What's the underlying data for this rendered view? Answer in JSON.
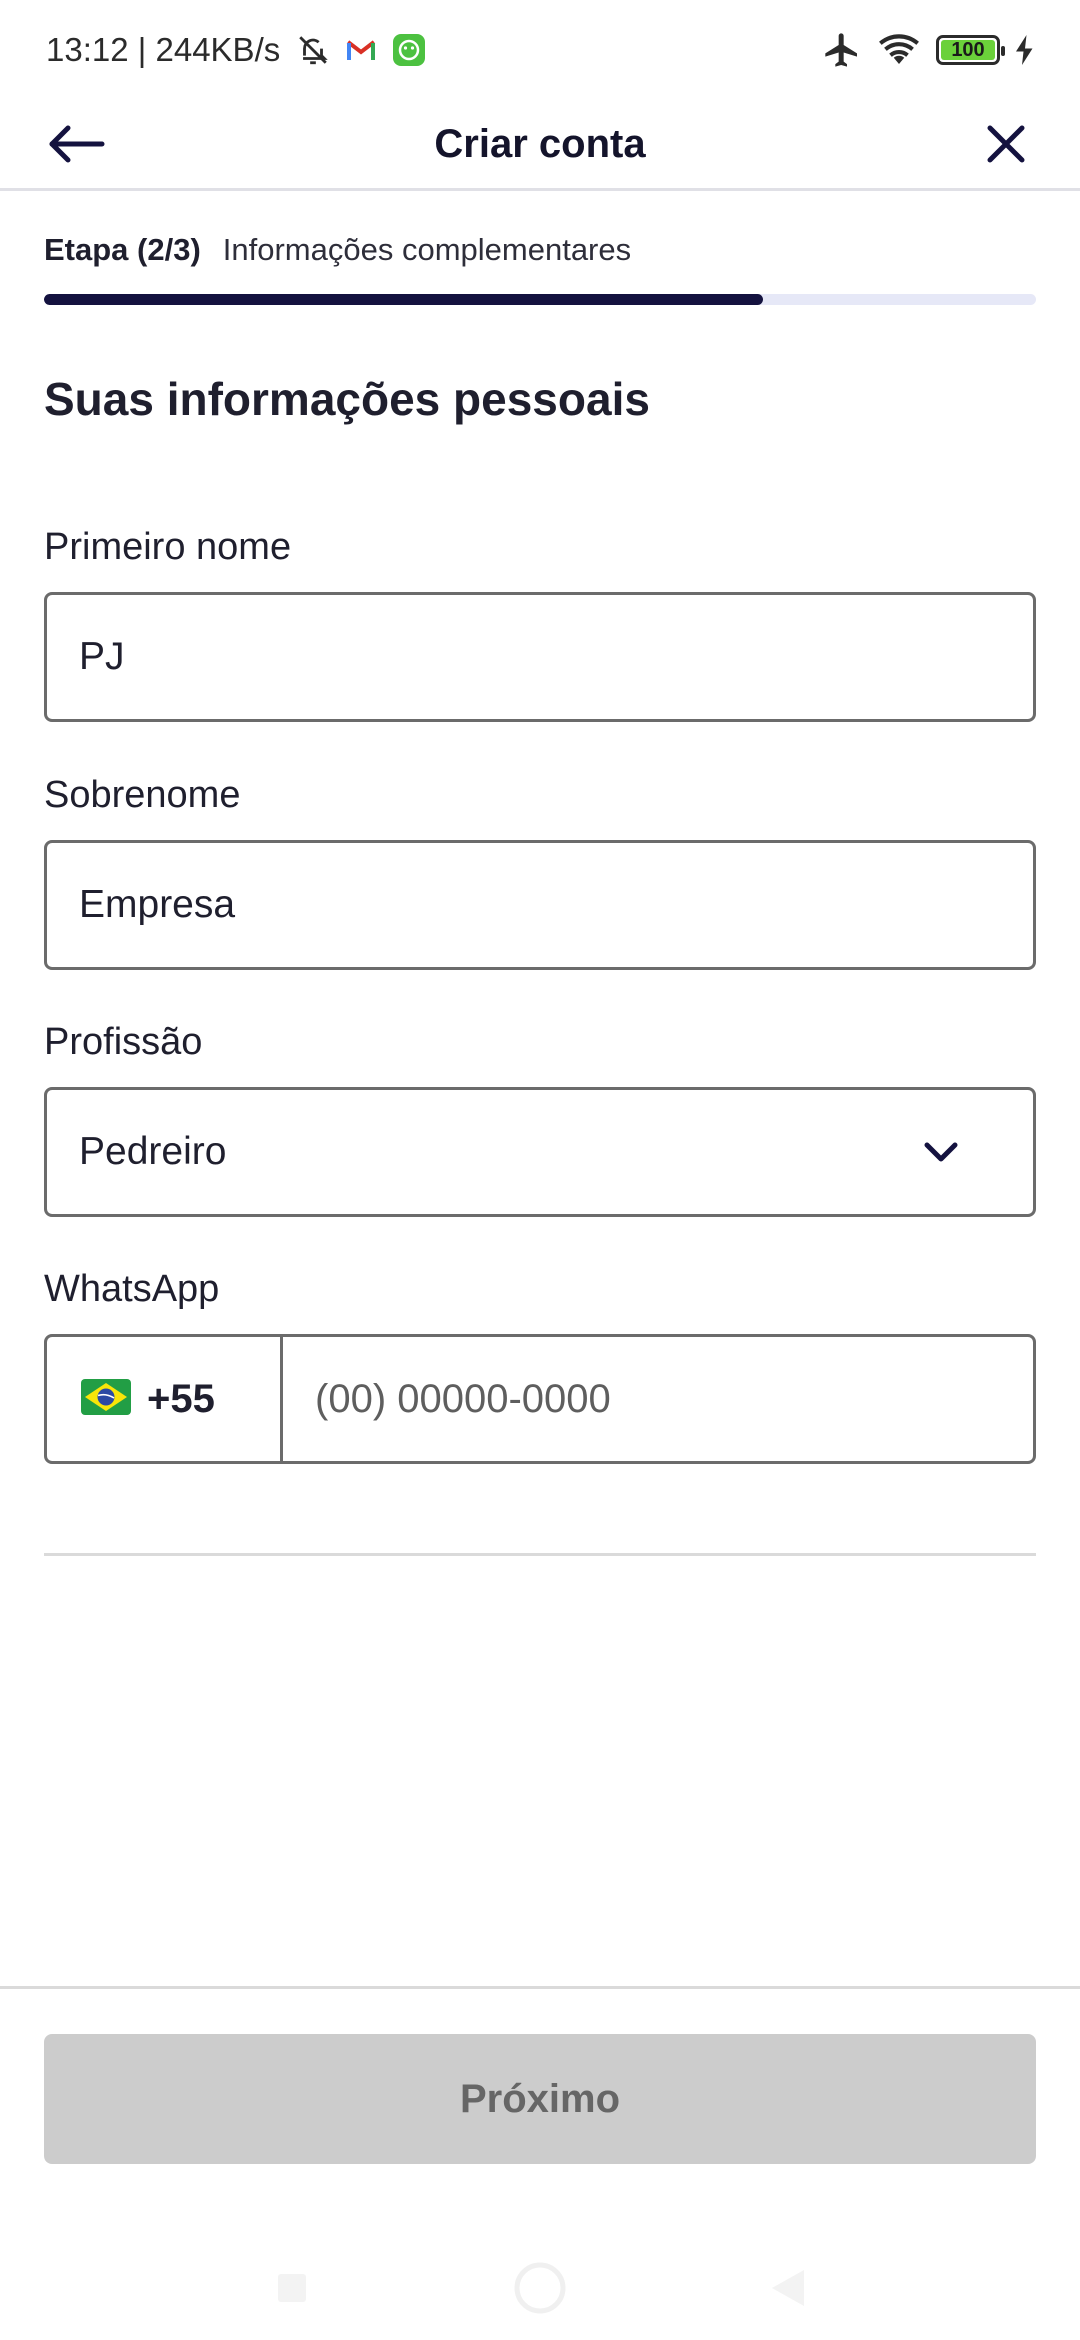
{
  "status_bar": {
    "time_speed": "13:12 | 244KB/s",
    "battery": "100"
  },
  "header": {
    "title": "Criar conta"
  },
  "step": {
    "label": "Etapa (2/3)",
    "description": "Informações complementares",
    "progress": 0.725
  },
  "form": {
    "section_title": "Suas informações pessoais",
    "first_name": {
      "label": "Primeiro nome",
      "value": "PJ"
    },
    "last_name": {
      "label": "Sobrenome",
      "value": "Empresa"
    },
    "profession": {
      "label": "Profissão",
      "value": "Pedreiro"
    },
    "whatsapp": {
      "label": "WhatsApp",
      "flag": "🇧🇷",
      "country_code": "+55",
      "placeholder": "(00) 00000-0000"
    }
  },
  "footer": {
    "next_label": "Próximo"
  },
  "colors": {
    "accent": "#14123f",
    "progress_track": "#e6e8f7",
    "disabled_button": "#cccccc"
  }
}
